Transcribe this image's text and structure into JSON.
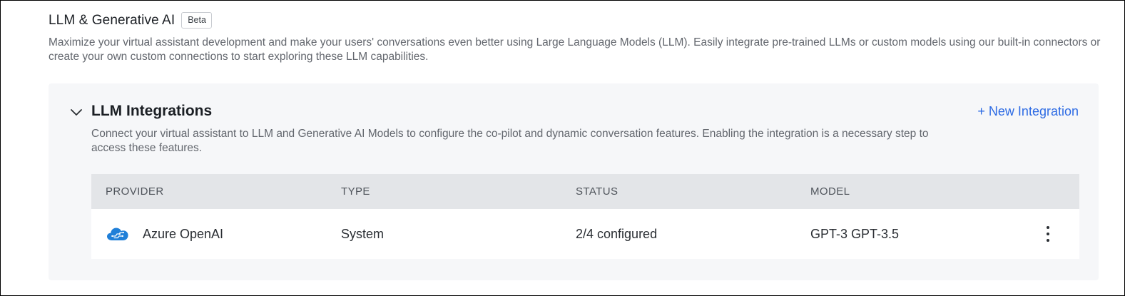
{
  "header": {
    "title": "LLM & Generative AI",
    "badge": "Beta",
    "description": "Maximize your virtual assistant development and make your users' conversations even better using Large Language Models (LLM). Easily integrate pre-trained LLMs or custom models using our built-in connectors or create your own custom connections to start exploring these LLM capabilities."
  },
  "integrations": {
    "title": "LLM Integrations",
    "new_button": "+ New Integration",
    "description": "Connect your virtual assistant to LLM and Generative AI Models to configure the co-pilot and dynamic conversation features. Enabling the integration is a necessary step to access these features.",
    "columns": [
      "PROVIDER",
      "TYPE",
      "STATUS",
      "MODEL"
    ],
    "rows": [
      {
        "icon": "azure-cloud-icon",
        "provider": "Azure OpenAI",
        "type": "System",
        "status": "2/4 configured",
        "model": "GPT-3 GPT-3.5"
      }
    ]
  },
  "colors": {
    "accent": "#2d6be4",
    "card_bg": "#f6f7f9",
    "table_header_bg": "#e3e5e8",
    "azure_icon": "#1f7fd8"
  }
}
